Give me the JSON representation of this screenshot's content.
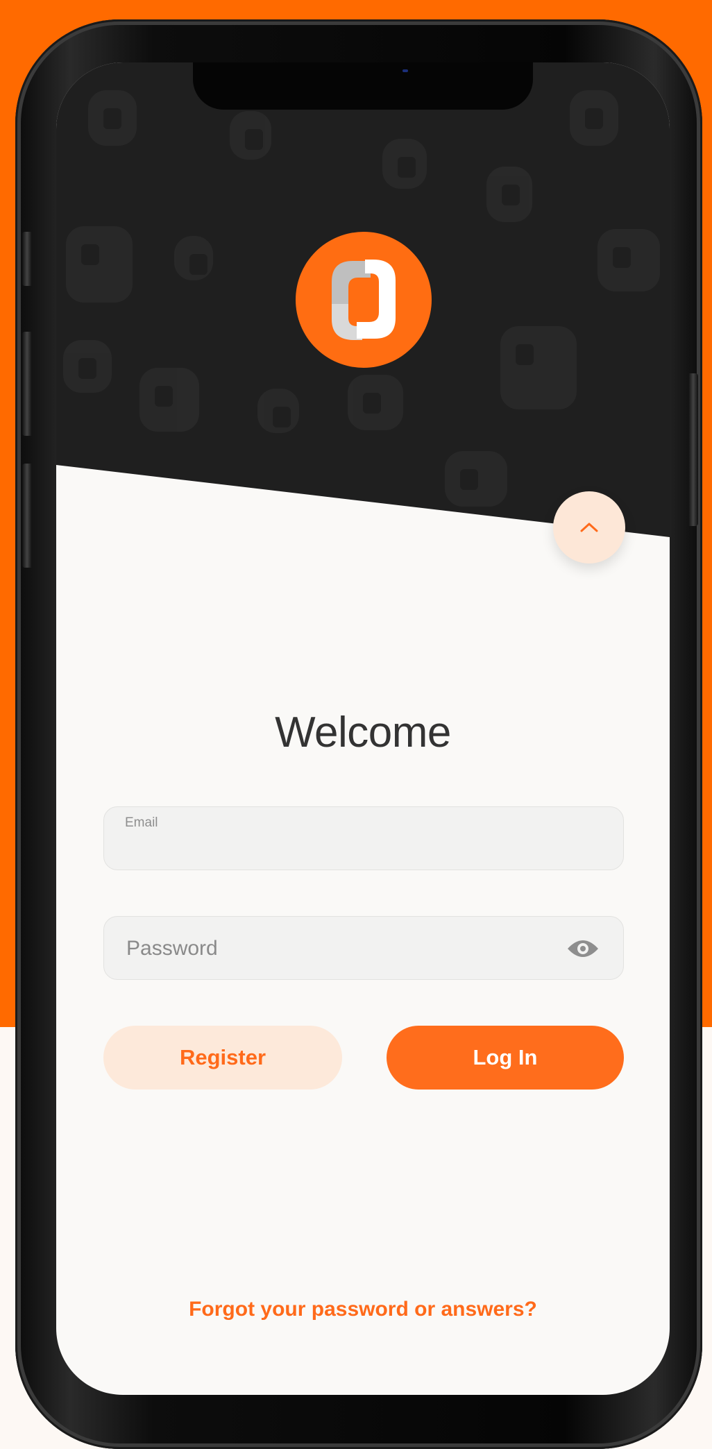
{
  "colors": {
    "accent": "#ff6a00",
    "button_primary": "#ff6d1c",
    "button_secondary_bg": "#fde9da",
    "dark_header": "#1f1f1f"
  },
  "header": {
    "logo_icon": "app-logo-icon",
    "scroll_up_icon": "chevron-up-icon"
  },
  "login": {
    "title": "Welcome",
    "email": {
      "label": "Email",
      "value": ""
    },
    "password": {
      "placeholder": "Password",
      "value": "",
      "toggle_icon": "eye-icon"
    },
    "register_label": "Register",
    "login_label": "Log In",
    "forgot_label": "Forgot your password or answers?"
  }
}
